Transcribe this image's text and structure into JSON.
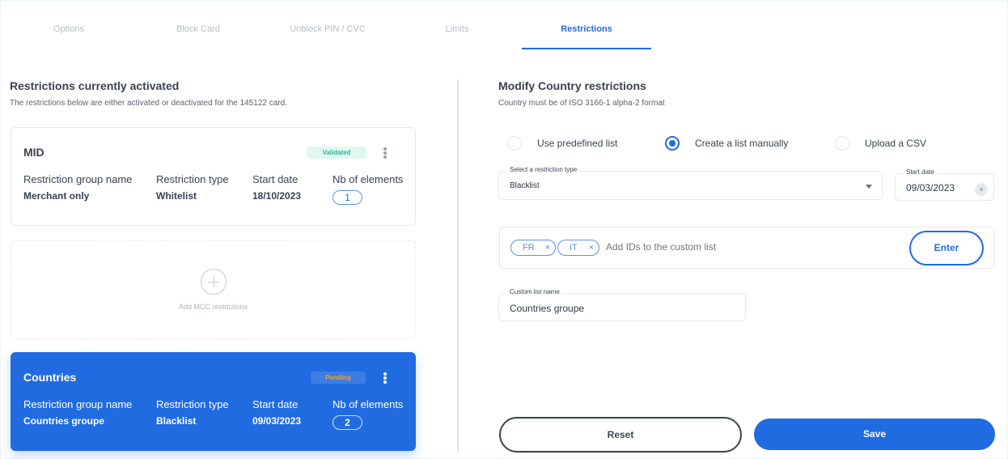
{
  "tabs": [
    {
      "label": "Options",
      "active": false
    },
    {
      "label": "Block Card",
      "active": false
    },
    {
      "label": "Unblock PIN / CVC",
      "active": false
    },
    {
      "label": "Limits",
      "active": false
    },
    {
      "label": "Restrictions",
      "active": true
    }
  ],
  "left": {
    "title": "Restrictions currently activated",
    "subtitle": "The restrictions below are either activated or deactivated for the 145122 card.",
    "columns": [
      "Restriction group name",
      "Restriction type",
      "Start date",
      "Nb of elements"
    ],
    "cards": [
      {
        "title": "MID",
        "status": "Validated",
        "group_name": "Merchant only",
        "type": "Whitelist",
        "start_date": "18/10/2023",
        "count": "1"
      },
      {
        "title": "Countries",
        "status": "Pending",
        "group_name": "Countries groupe",
        "type": "Blacklist",
        "start_date": "09/03/2023",
        "count": "2"
      }
    ],
    "add_label": "Add MCC restrictions"
  },
  "right": {
    "title": "Modify Country restrictions",
    "subtitle": "Country must be of ISO 3166-1 alpha-2 format",
    "radios": [
      {
        "label": "Use predefined list",
        "checked": false
      },
      {
        "label": "Create a list manually",
        "checked": true
      },
      {
        "label": "Upload a CSV",
        "checked": false
      }
    ],
    "restriction_type": {
      "label": "Select a restriction type",
      "value": "Blacklist"
    },
    "start_date": {
      "label": "Start date",
      "value": "09/03/2023"
    },
    "chips": [
      "FR",
      "IT"
    ],
    "chips_placeholder": "Add IDs to the custom list",
    "enter_label": "Enter",
    "custom_list_name": {
      "label": "Custom list name",
      "value": "Countries groupe"
    },
    "reset_label": "Reset",
    "save_label": "Save"
  },
  "colors": {
    "accent": "#216be0",
    "validated": "#2db896",
    "pending": "#f0a02a"
  }
}
